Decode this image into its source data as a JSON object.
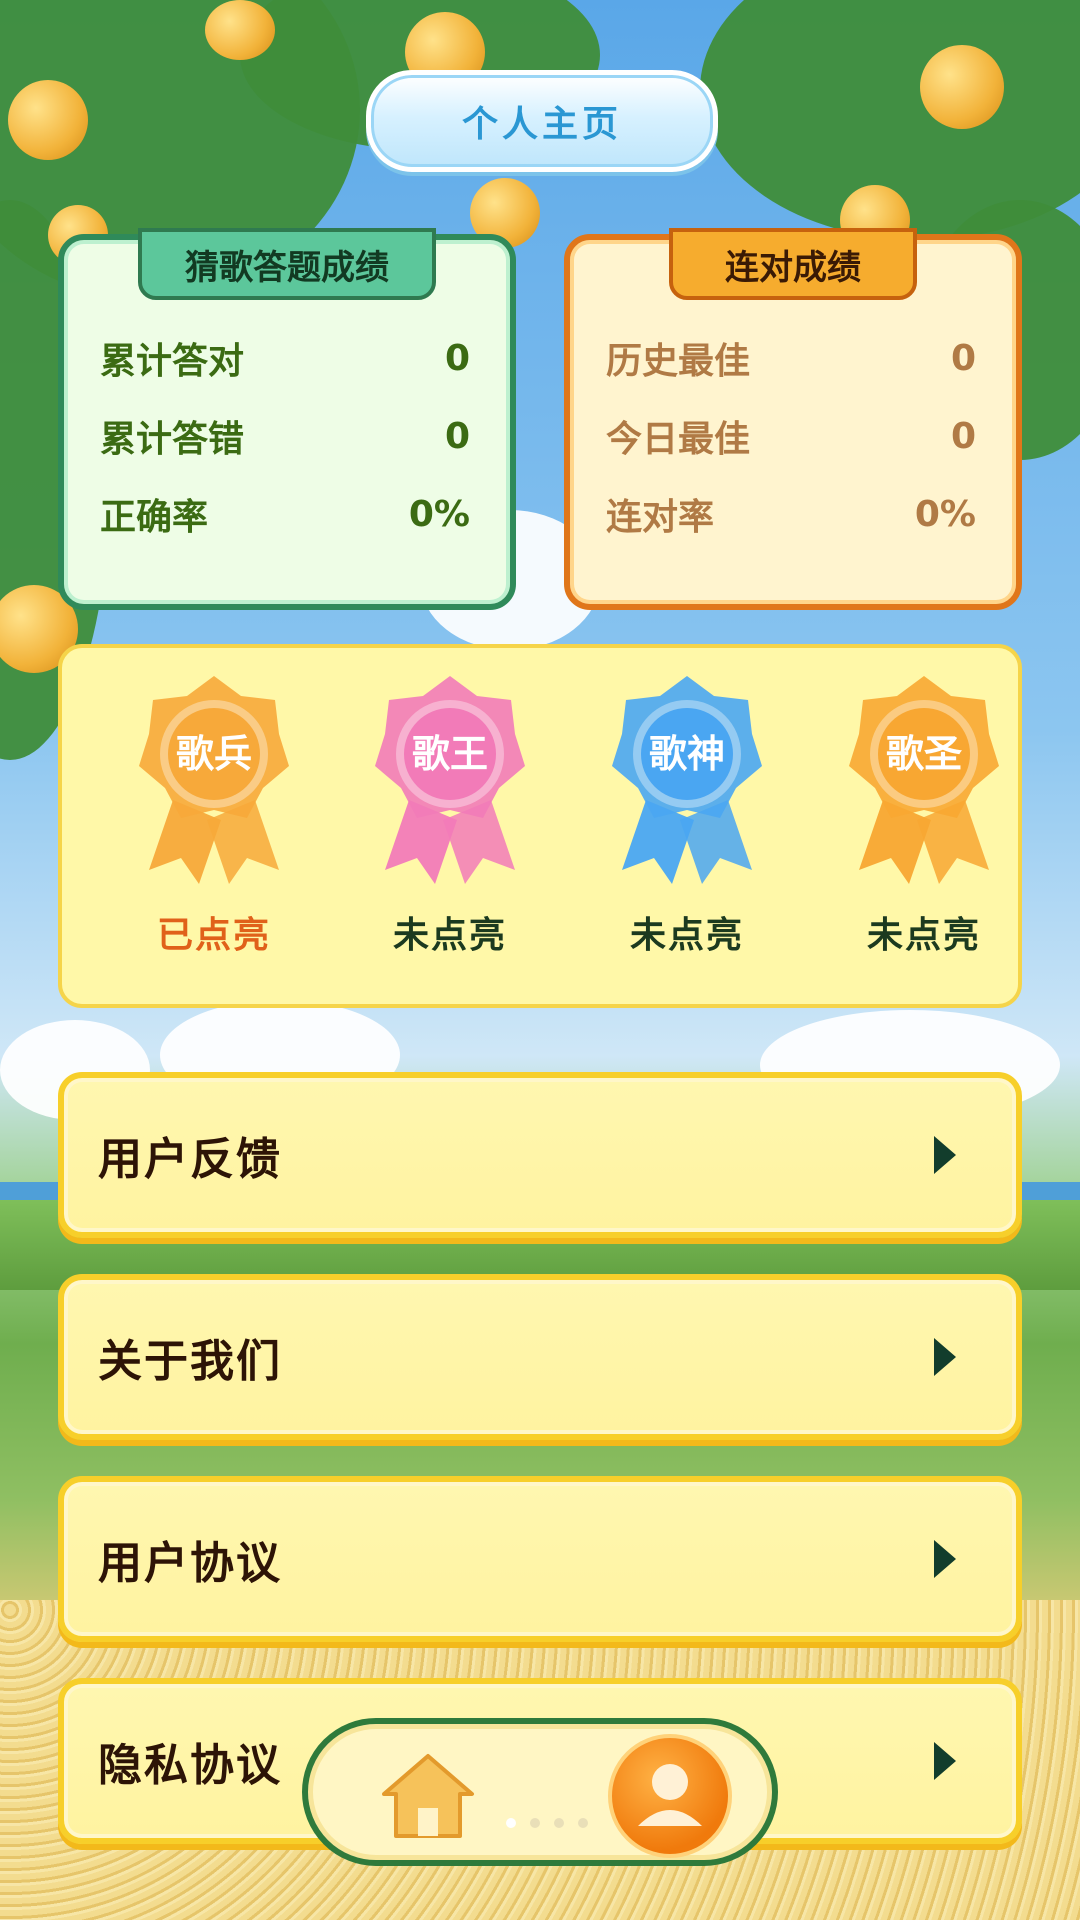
{
  "header": {
    "title": "个人主页"
  },
  "quiz_card": {
    "title": "猜歌答题成绩",
    "rows": [
      {
        "label": "累计答对",
        "value": "0"
      },
      {
        "label": "累计答错",
        "value": "0"
      },
      {
        "label": "正确率",
        "value": "0%"
      }
    ]
  },
  "streak_card": {
    "title": "连对成绩",
    "rows": [
      {
        "label": "历史最佳",
        "value": "0"
      },
      {
        "label": "今日最佳",
        "value": "0"
      },
      {
        "label": "连对率",
        "value": "0%"
      }
    ]
  },
  "badges": [
    {
      "name": "歌兵",
      "status": "已点亮",
      "lit": true,
      "color": "#f7a93a"
    },
    {
      "name": "歌王",
      "status": "未点亮",
      "lit": false,
      "color": "#f27bb8"
    },
    {
      "name": "歌神",
      "status": "未点亮",
      "lit": false,
      "color": "#4aa6f2"
    },
    {
      "name": "歌圣",
      "status": "未点亮",
      "lit": false,
      "color": "#f8a732"
    }
  ],
  "menu": [
    {
      "label": "用户反馈"
    },
    {
      "label": "关于我们"
    },
    {
      "label": "用户协议"
    },
    {
      "label": "隐私协议"
    }
  ],
  "bottom_nav": {
    "items": [
      {
        "icon": "home-icon",
        "active": false
      },
      {
        "icon": "profile-icon",
        "active": true
      }
    ]
  },
  "colors": {
    "accent_green": "#2f8a5a",
    "accent_orange": "#e0761a",
    "menu_bg": "#fff7b0"
  }
}
